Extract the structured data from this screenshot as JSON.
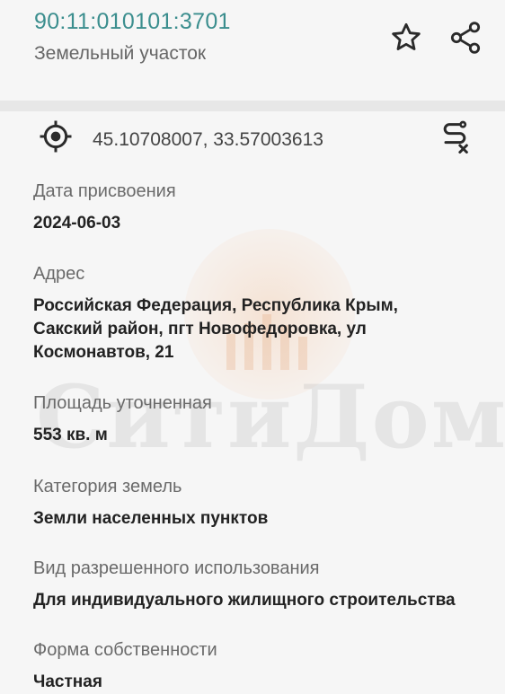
{
  "header": {
    "cadastral_number": "90:11:010101:3701",
    "object_type": "Земельный участок",
    "favorite_icon": "star-outline-icon",
    "share_icon": "share-icon"
  },
  "location": {
    "coordinates": "45.10708007, 33.57003613",
    "locate_icon": "gps-target-icon",
    "route_icon": "route-clear-icon"
  },
  "watermark": {
    "text": "СитиДом"
  },
  "fields": [
    {
      "label": "Дата присвоения",
      "value": "2024-06-03"
    },
    {
      "label": "Адрес",
      "value": "Российская Федерация, Республика Крым, Сакский район, пгт Новофедоровка, ул Космонавтов, 21"
    },
    {
      "label": "Площадь уточненная",
      "value": "553 кв. м"
    },
    {
      "label": "Категория земель",
      "value": "Земли населенных пунктов"
    },
    {
      "label": "Вид разрешенного использования",
      "value": "Для индивидуального жилищного строительства"
    },
    {
      "label": "Форма собственности",
      "value": "Частная"
    }
  ]
}
